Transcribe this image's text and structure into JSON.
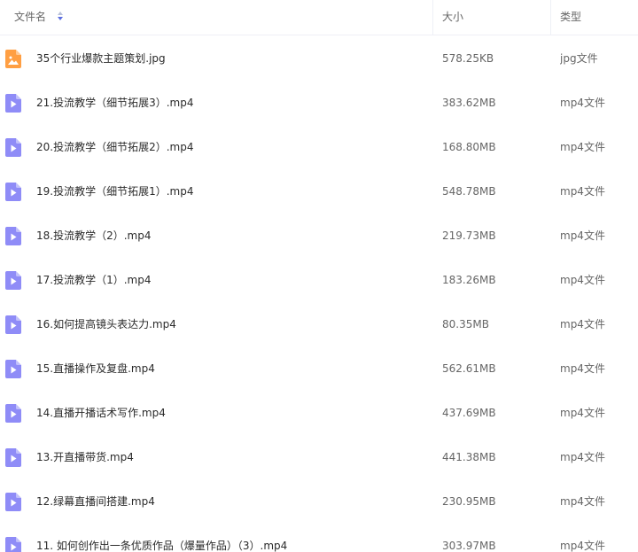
{
  "header": {
    "name_label": "文件名",
    "size_label": "大小",
    "type_label": "类型"
  },
  "colors": {
    "video_icon": "#8f8cf7",
    "image_icon": "#ff9f43"
  },
  "files": [
    {
      "icon": "image-icon",
      "name": "35个行业爆款主题策划.jpg",
      "size": "578.25KB",
      "type": "jpg文件"
    },
    {
      "icon": "video-icon",
      "name": "21.投流教学（细节拓展3）.mp4",
      "size": "383.62MB",
      "type": "mp4文件"
    },
    {
      "icon": "video-icon",
      "name": "20.投流教学（细节拓展2）.mp4",
      "size": "168.80MB",
      "type": "mp4文件"
    },
    {
      "icon": "video-icon",
      "name": "19.投流教学（细节拓展1）.mp4",
      "size": "548.78MB",
      "type": "mp4文件"
    },
    {
      "icon": "video-icon",
      "name": "18.投流教学（2）.mp4",
      "size": "219.73MB",
      "type": "mp4文件"
    },
    {
      "icon": "video-icon",
      "name": "17.投流教学（1）.mp4",
      "size": "183.26MB",
      "type": "mp4文件"
    },
    {
      "icon": "video-icon",
      "name": "16.如何提高镜头表达力.mp4",
      "size": "80.35MB",
      "type": "mp4文件"
    },
    {
      "icon": "video-icon",
      "name": "15.直播操作及复盘.mp4",
      "size": "562.61MB",
      "type": "mp4文件"
    },
    {
      "icon": "video-icon",
      "name": "14.直播开播话术写作.mp4",
      "size": "437.69MB",
      "type": "mp4文件"
    },
    {
      "icon": "video-icon",
      "name": "13.开直播带货.mp4",
      "size": "441.38MB",
      "type": "mp4文件"
    },
    {
      "icon": "video-icon",
      "name": "12.绿幕直播间搭建.mp4",
      "size": "230.95MB",
      "type": "mp4文件"
    },
    {
      "icon": "video-icon",
      "name": "11. 如何创作出一条优质作品（爆量作品）（3）.mp4",
      "size": "303.97MB",
      "type": "mp4文件"
    }
  ]
}
